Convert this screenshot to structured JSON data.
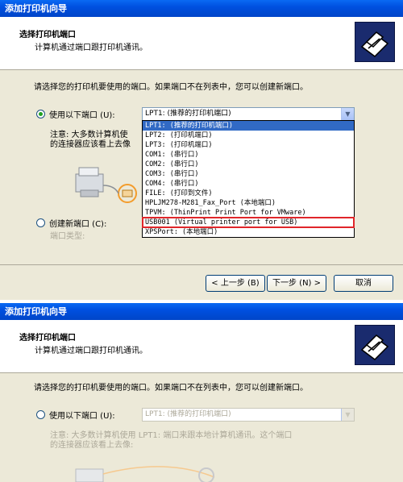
{
  "window1": {
    "title": "添加打印机向导",
    "header_title": "选择打印机端口",
    "header_subtitle": "计算机通过端口跟打印机通讯。",
    "instruction": "请选择您的打印机要使用的端口。如果端口不在列表中，您可以创建新端口。",
    "use_port_label": "使用以下端口 (U):",
    "selected_port": "LPT1: (推荐的打印机端口)",
    "note_line1": "注意: 大多数计算机使",
    "note_line2": "的连接器应该看上去像",
    "create_port_label": "创建新端口 (C):",
    "port_type_label": "端口类型:",
    "dropdown_items": [
      "LPT1: (推荐的打印机端口)",
      "LPT2: (打印机端口)",
      "LPT3: (打印机端口)",
      "COM1: (串行口)",
      "COM2: (串行口)",
      "COM3: (串行口)",
      "COM4: (串行口)",
      "FILE: (打印到文件)",
      "HPLJM278-M281_Fax_Port (本地端口)",
      "TPVM: (ThinPrint Print Port for VMware)",
      "USB001 (Virtual printer port for USB)",
      "XPSPort: (本地端口)"
    ],
    "back_button": "< 上一步 (B)",
    "next_button": "下一步 (N) >",
    "cancel_button": "取消"
  },
  "window2": {
    "title": "添加打印机向导",
    "header_title": "选择打印机端口",
    "header_subtitle": "计算机通过端口跟打印机通讯。",
    "instruction": "请选择您的打印机要使用的端口。如果端口不在列表中，您可以创建新端口。",
    "use_port_label": "使用以下端口 (U):",
    "selected_port": "LPT1: (推荐的打印机端口)",
    "note_line1": "注意: 大多数计算机使用 LPT1: 端口来跟本地计算机通讯。这个端口",
    "note_line2": "的连接器应该看上去像:"
  },
  "colors": {
    "title_blue": "#0050e0",
    "dialog_bg": "#ece9d8",
    "selection_blue": "#316ac5",
    "highlight_red": "#e0262a"
  }
}
